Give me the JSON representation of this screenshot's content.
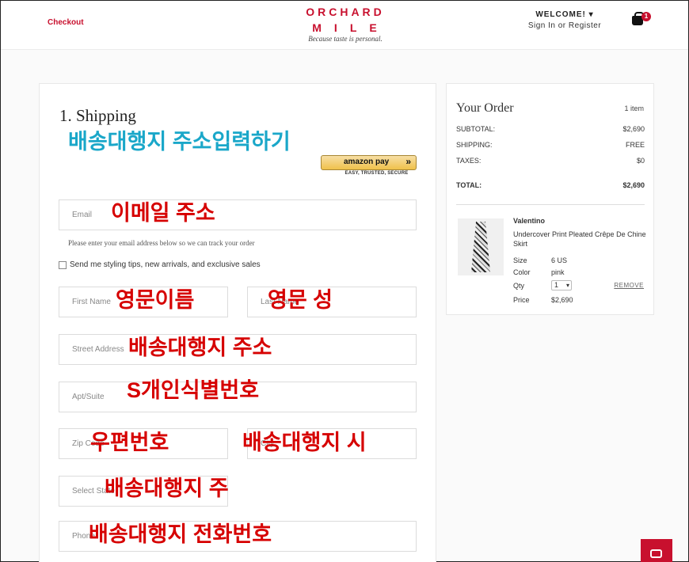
{
  "header": {
    "checkout_label": "Checkout",
    "logo_line1": "ORCHARD",
    "logo_line2": "MILE",
    "tagline": "Because taste is personal.",
    "welcome": "WELCOME! ▾",
    "signin": "Sign In or Register",
    "cart_count": "1"
  },
  "shipping": {
    "title": "1. Shipping",
    "amazon_pay": {
      "label": "amazon pay",
      "arrow": "»",
      "sub": "EASY, TRUSTED, SECURE"
    },
    "email_placeholder": "Email",
    "email_helper": "Please enter your email address below so we can track your order",
    "optin_label": "Send me styling tips, new arrivals, and exclusive sales",
    "first_name_placeholder": "First Name",
    "last_name_placeholder": "Last Name",
    "street_placeholder": "Street Address",
    "apt_placeholder": "Apt/Suite",
    "zip_placeholder": "Zip Code",
    "city_placeholder": "City",
    "state_placeholder": "Select State",
    "phone_placeholder": "Phone"
  },
  "annotations": {
    "header_note": "배송대행지 주소입력하기",
    "email": "이메일 주소",
    "first_name": "영문이름",
    "last_name": "영문 성",
    "street": "배송대행지 주소",
    "apt": "S개인식별번호",
    "zip": "우편번호",
    "city": "배송대행지 시",
    "state": "배송대행지 주",
    "phone": "배송대행지 전화번호"
  },
  "order": {
    "title": "Your Order",
    "count": "1 item",
    "subtotal_label": "SUBTOTAL:",
    "subtotal_value": "$2,690",
    "shipping_label": "SHIPPING:",
    "shipping_value": "FREE",
    "taxes_label": "TAXES:",
    "taxes_value": "$0",
    "total_label": "TOTAL:",
    "total_value": "$2,690",
    "item": {
      "brand": "Valentino",
      "name": "Undercover Print Pleated Crêpe De Chine Skirt",
      "size_label": "Size",
      "size_value": "6 US",
      "color_label": "Color",
      "color_value": "pink",
      "qty_label": "Qty",
      "qty_value": "1",
      "price_label": "Price",
      "price_value": "$2,690",
      "remove_label": "REMOVE"
    }
  },
  "colors": {
    "brand_red": "#c8102e",
    "overlay_red": "#d60000",
    "overlay_cyan": "#1aa7c9"
  }
}
